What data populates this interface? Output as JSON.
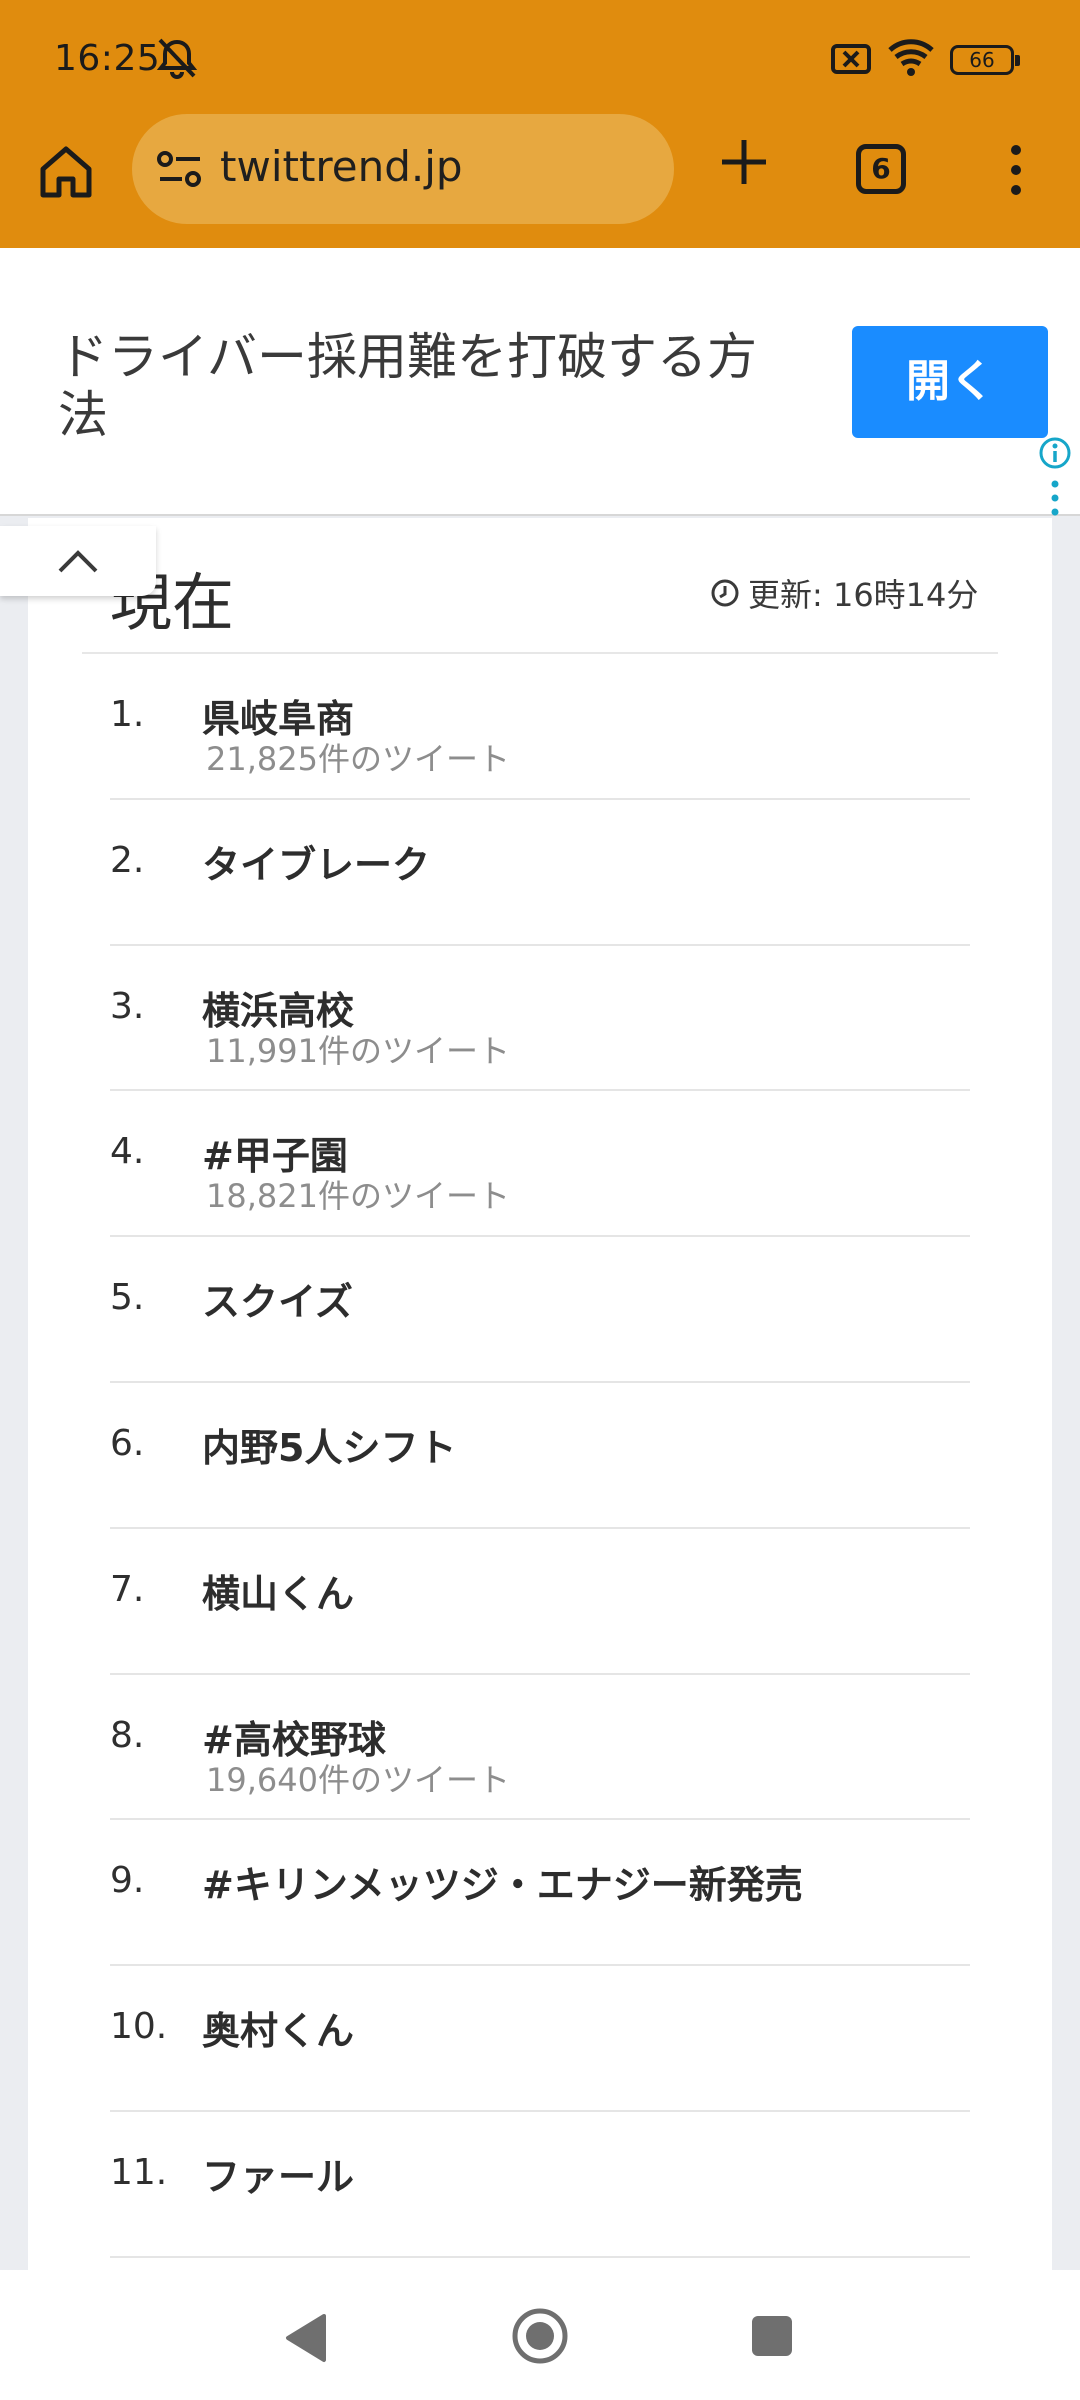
{
  "status_bar": {
    "time": "16:25",
    "battery": "66",
    "icons": [
      "bell-off-icon",
      "data-off-icon",
      "wifi-icon",
      "battery-icon"
    ]
  },
  "browser": {
    "url": "twittrend.jp",
    "tab_count": "6",
    "accent_color": "#e08c0e",
    "icons": [
      "home-icon",
      "site-info-icon",
      "new-tab-icon",
      "tabs-icon",
      "menu-icon"
    ]
  },
  "ad": {
    "text": "ドライバー採用難を打破する方法",
    "button_label": "開く",
    "button_color": "#1a8cff",
    "icons": [
      "info-icon",
      "ad-options-icon",
      "chevron-up-icon"
    ]
  },
  "main": {
    "heading": "現在",
    "updated_label": "更新: 16時14分",
    "trends": [
      {
        "rank": "1.",
        "name": "県岐阜商",
        "count": "21,825件のツイート"
      },
      {
        "rank": "2.",
        "name": "タイブレーク",
        "count": ""
      },
      {
        "rank": "3.",
        "name": "横浜高校",
        "count": "11,991件のツイート"
      },
      {
        "rank": "4.",
        "name": "#甲子園",
        "count": "18,821件のツイート"
      },
      {
        "rank": "5.",
        "name": "スクイズ",
        "count": ""
      },
      {
        "rank": "6.",
        "name": "内野5人シフト",
        "count": ""
      },
      {
        "rank": "7.",
        "name": "横山くん",
        "count": ""
      },
      {
        "rank": "8.",
        "name": "#高校野球",
        "count": "19,640件のツイート"
      },
      {
        "rank": "9.",
        "name": "#キリンメッツジ・エナジー新発売",
        "count": ""
      },
      {
        "rank": "10.",
        "name": "奥村くん",
        "count": ""
      },
      {
        "rank": "11.",
        "name": "ファール",
        "count": ""
      }
    ]
  },
  "nav_bar": {
    "icons": [
      "back-icon",
      "home-circle-icon",
      "recents-icon"
    ]
  }
}
